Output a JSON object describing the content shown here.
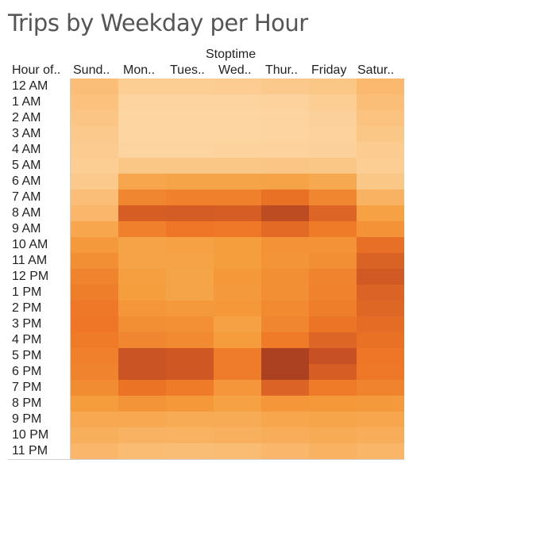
{
  "title": "Trips by Weekday per Hour",
  "chart_data": {
    "type": "heatmap",
    "title": "Trips by Weekday per Hour",
    "column_group_label": "Stoptime",
    "row_header": "Hour of..",
    "columns": [
      "Sund..",
      "Mon..",
      "Tues..",
      "Wed..",
      "Thur..",
      "Friday",
      "Satur.."
    ],
    "rows": [
      "12 AM",
      "1 AM",
      "2 AM",
      "3 AM",
      "4 AM",
      "5 AM",
      "6 AM",
      "7 AM",
      "8 AM",
      "9 AM",
      "10 AM",
      "11 AM",
      "12 PM",
      "1 PM",
      "2 PM",
      "3 PM",
      "4 PM",
      "5 PM",
      "6 PM",
      "7 PM",
      "8 PM",
      "9 PM",
      "10 PM",
      "11 PM"
    ],
    "color_scale": [
      "#fdd8a6",
      "#a03a20"
    ],
    "values": [
      [
        0.17,
        0.06,
        0.06,
        0.07,
        0.09,
        0.11,
        0.21
      ],
      [
        0.15,
        0.02,
        0.02,
        0.02,
        0.03,
        0.06,
        0.17
      ],
      [
        0.12,
        0.01,
        0.01,
        0.01,
        0.02,
        0.04,
        0.14
      ],
      [
        0.09,
        0.01,
        0.01,
        0.01,
        0.02,
        0.03,
        0.11
      ],
      [
        0.08,
        0.02,
        0.02,
        0.03,
        0.03,
        0.04,
        0.08
      ],
      [
        0.06,
        0.11,
        0.11,
        0.11,
        0.12,
        0.11,
        0.06
      ],
      [
        0.09,
        0.34,
        0.36,
        0.36,
        0.37,
        0.32,
        0.11
      ],
      [
        0.17,
        0.52,
        0.55,
        0.55,
        0.63,
        0.52,
        0.26
      ],
      [
        0.22,
        0.74,
        0.75,
        0.74,
        0.86,
        0.7,
        0.38
      ],
      [
        0.34,
        0.55,
        0.6,
        0.59,
        0.67,
        0.58,
        0.46
      ],
      [
        0.42,
        0.37,
        0.38,
        0.4,
        0.46,
        0.46,
        0.64
      ],
      [
        0.48,
        0.37,
        0.37,
        0.4,
        0.45,
        0.48,
        0.72
      ],
      [
        0.53,
        0.39,
        0.36,
        0.43,
        0.48,
        0.53,
        0.77
      ],
      [
        0.56,
        0.4,
        0.36,
        0.42,
        0.48,
        0.54,
        0.71
      ],
      [
        0.59,
        0.44,
        0.42,
        0.43,
        0.5,
        0.56,
        0.69
      ],
      [
        0.6,
        0.48,
        0.47,
        0.38,
        0.52,
        0.61,
        0.66
      ],
      [
        0.58,
        0.52,
        0.5,
        0.41,
        0.58,
        0.7,
        0.63
      ],
      [
        0.55,
        0.8,
        0.78,
        0.57,
        0.95,
        0.82,
        0.6
      ],
      [
        0.53,
        0.8,
        0.78,
        0.57,
        0.95,
        0.74,
        0.59
      ],
      [
        0.49,
        0.62,
        0.58,
        0.44,
        0.71,
        0.58,
        0.53
      ],
      [
        0.41,
        0.45,
        0.43,
        0.38,
        0.44,
        0.43,
        0.42
      ],
      [
        0.33,
        0.33,
        0.31,
        0.31,
        0.34,
        0.35,
        0.34
      ],
      [
        0.28,
        0.26,
        0.26,
        0.27,
        0.29,
        0.31,
        0.29
      ],
      [
        0.22,
        0.19,
        0.18,
        0.19,
        0.22,
        0.26,
        0.23
      ]
    ]
  }
}
